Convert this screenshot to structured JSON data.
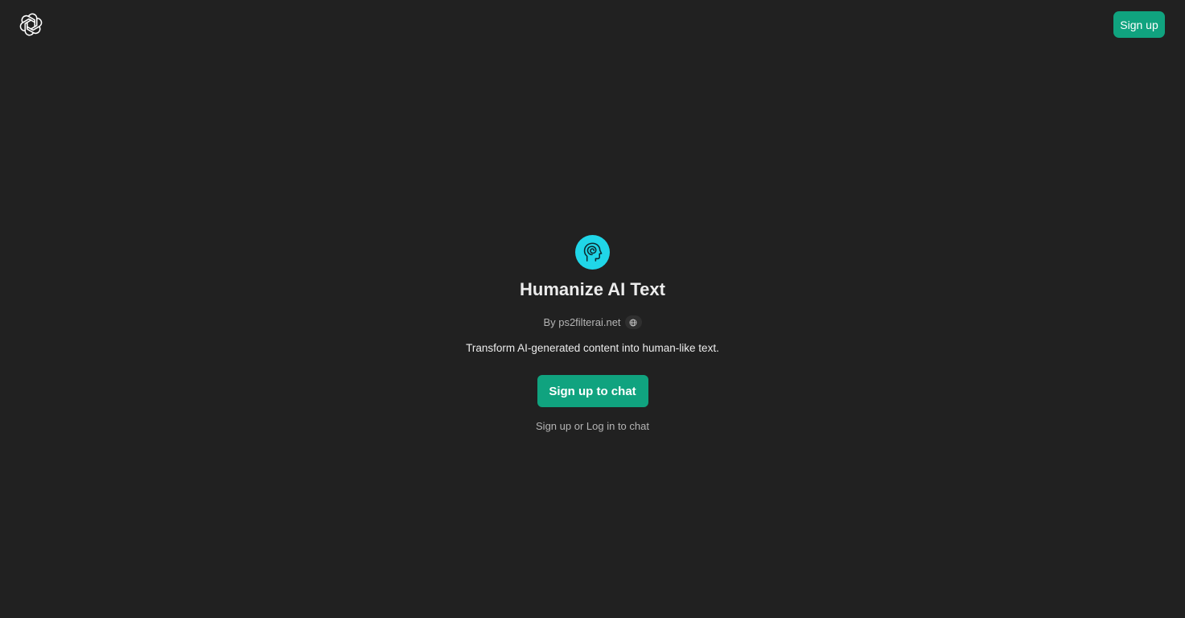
{
  "header": {
    "logo_icon": "openai-logo-icon",
    "signup_label": "Sign up"
  },
  "gpt": {
    "avatar_icon": "human-head-spiral-icon",
    "avatar_color": "#20d6e8",
    "title": "Humanize AI Text",
    "byline": "By ps2filterai.net",
    "website_icon": "globe-icon",
    "description": "Transform AI-generated content into human-like text."
  },
  "actions": {
    "cta_label": "Sign up to chat",
    "signup_link": "Sign up",
    "or_text": " or ",
    "login_link": "Log in",
    "to_chat_text": " to chat"
  },
  "colors": {
    "background": "#212121",
    "accent": "#10a37f"
  }
}
